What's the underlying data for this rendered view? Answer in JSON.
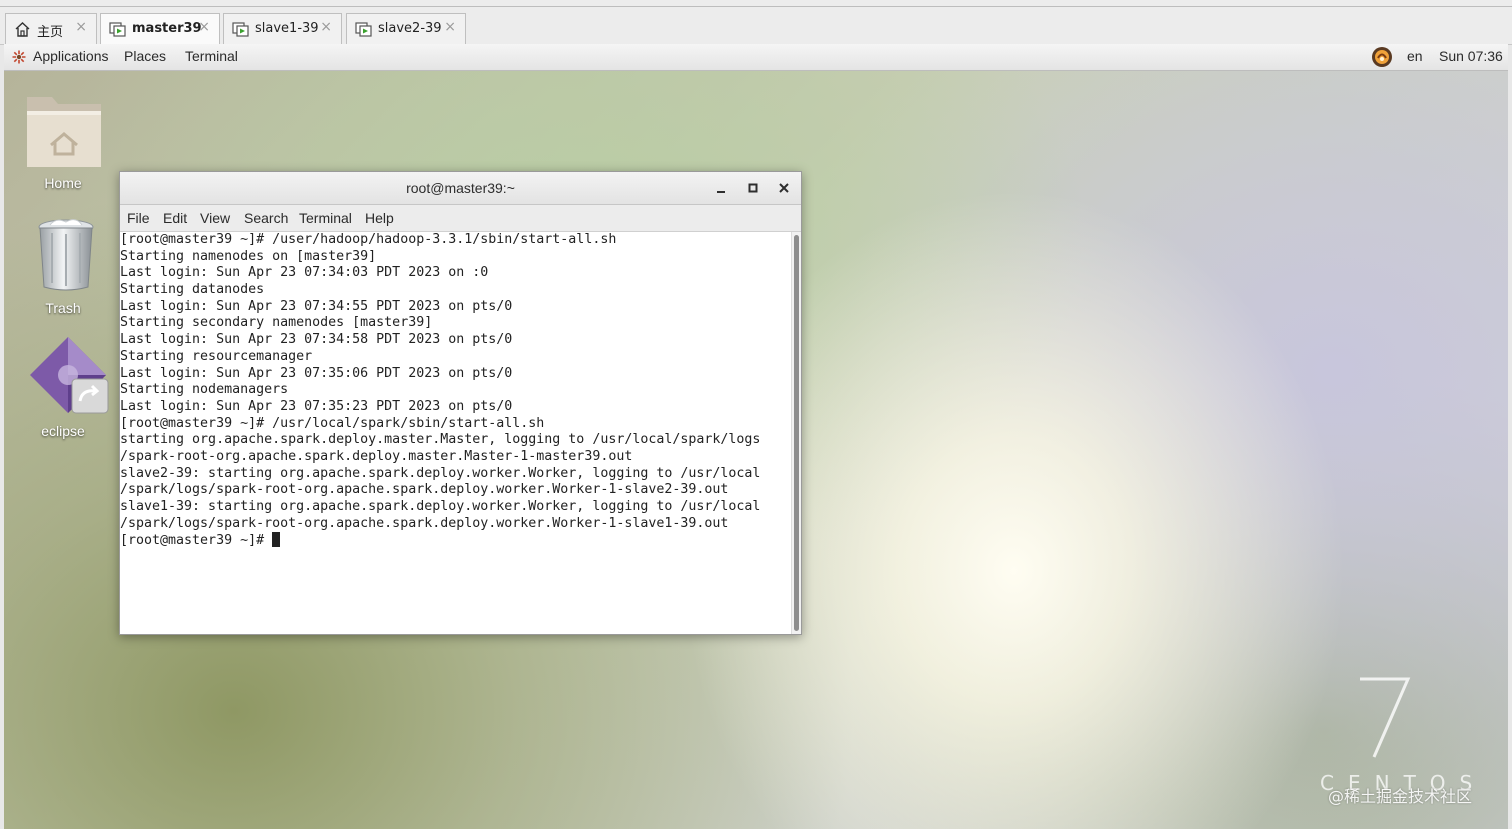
{
  "vm_tabs": [
    {
      "label": "主页",
      "icon": "home-icon",
      "active": false
    },
    {
      "label": "master39",
      "icon": "vm-icon",
      "active": true
    },
    {
      "label": "slave1-39",
      "icon": "vm-icon",
      "active": false
    },
    {
      "label": "slave2-39",
      "icon": "vm-icon",
      "active": false
    }
  ],
  "tab_close_glyph": "×",
  "panel": {
    "applications": "Applications",
    "places": "Places",
    "terminal": "Terminal",
    "language": "en",
    "clock": "Sun 07:36"
  },
  "desktop": {
    "icons": [
      {
        "label": "Home",
        "icon": "home-folder-icon"
      },
      {
        "label": "Trash",
        "icon": "trash-icon"
      },
      {
        "label": "eclipse",
        "icon": "eclipse-launcher-icon"
      }
    ],
    "wallpaper_word": "CENTOS",
    "watermark": "@稀土掘金技术社区"
  },
  "terminal": {
    "title": "root@master39:~",
    "menu": [
      "File",
      "Edit",
      "View",
      "Search",
      "Terminal",
      "Help"
    ],
    "lines": [
      "[root@master39 ~]# /user/hadoop/hadoop-3.3.1/sbin/start-all.sh",
      "Starting namenodes on [master39]",
      "Last login: Sun Apr 23 07:34:03 PDT 2023 on :0",
      "Starting datanodes",
      "Last login: Sun Apr 23 07:34:55 PDT 2023 on pts/0",
      "Starting secondary namenodes [master39]",
      "Last login: Sun Apr 23 07:34:58 PDT 2023 on pts/0",
      "Starting resourcemanager",
      "Last login: Sun Apr 23 07:35:06 PDT 2023 on pts/0",
      "Starting nodemanagers",
      "Last login: Sun Apr 23 07:35:23 PDT 2023 on pts/0",
      "[root@master39 ~]# /usr/local/spark/sbin/start-all.sh",
      "starting org.apache.spark.deploy.master.Master, logging to /usr/local/spark/logs",
      "/spark-root-org.apache.spark.deploy.master.Master-1-master39.out",
      "slave2-39: starting org.apache.spark.deploy.worker.Worker, logging to /usr/local",
      "/spark/logs/spark-root-org.apache.spark.deploy.worker.Worker-1-slave2-39.out",
      "slave1-39: starting org.apache.spark.deploy.worker.Worker, logging to /usr/local",
      "/spark/logs/spark-root-org.apache.spark.deploy.worker.Worker-1-slave1-39.out"
    ],
    "prompt": "[root@master39 ~]# "
  }
}
